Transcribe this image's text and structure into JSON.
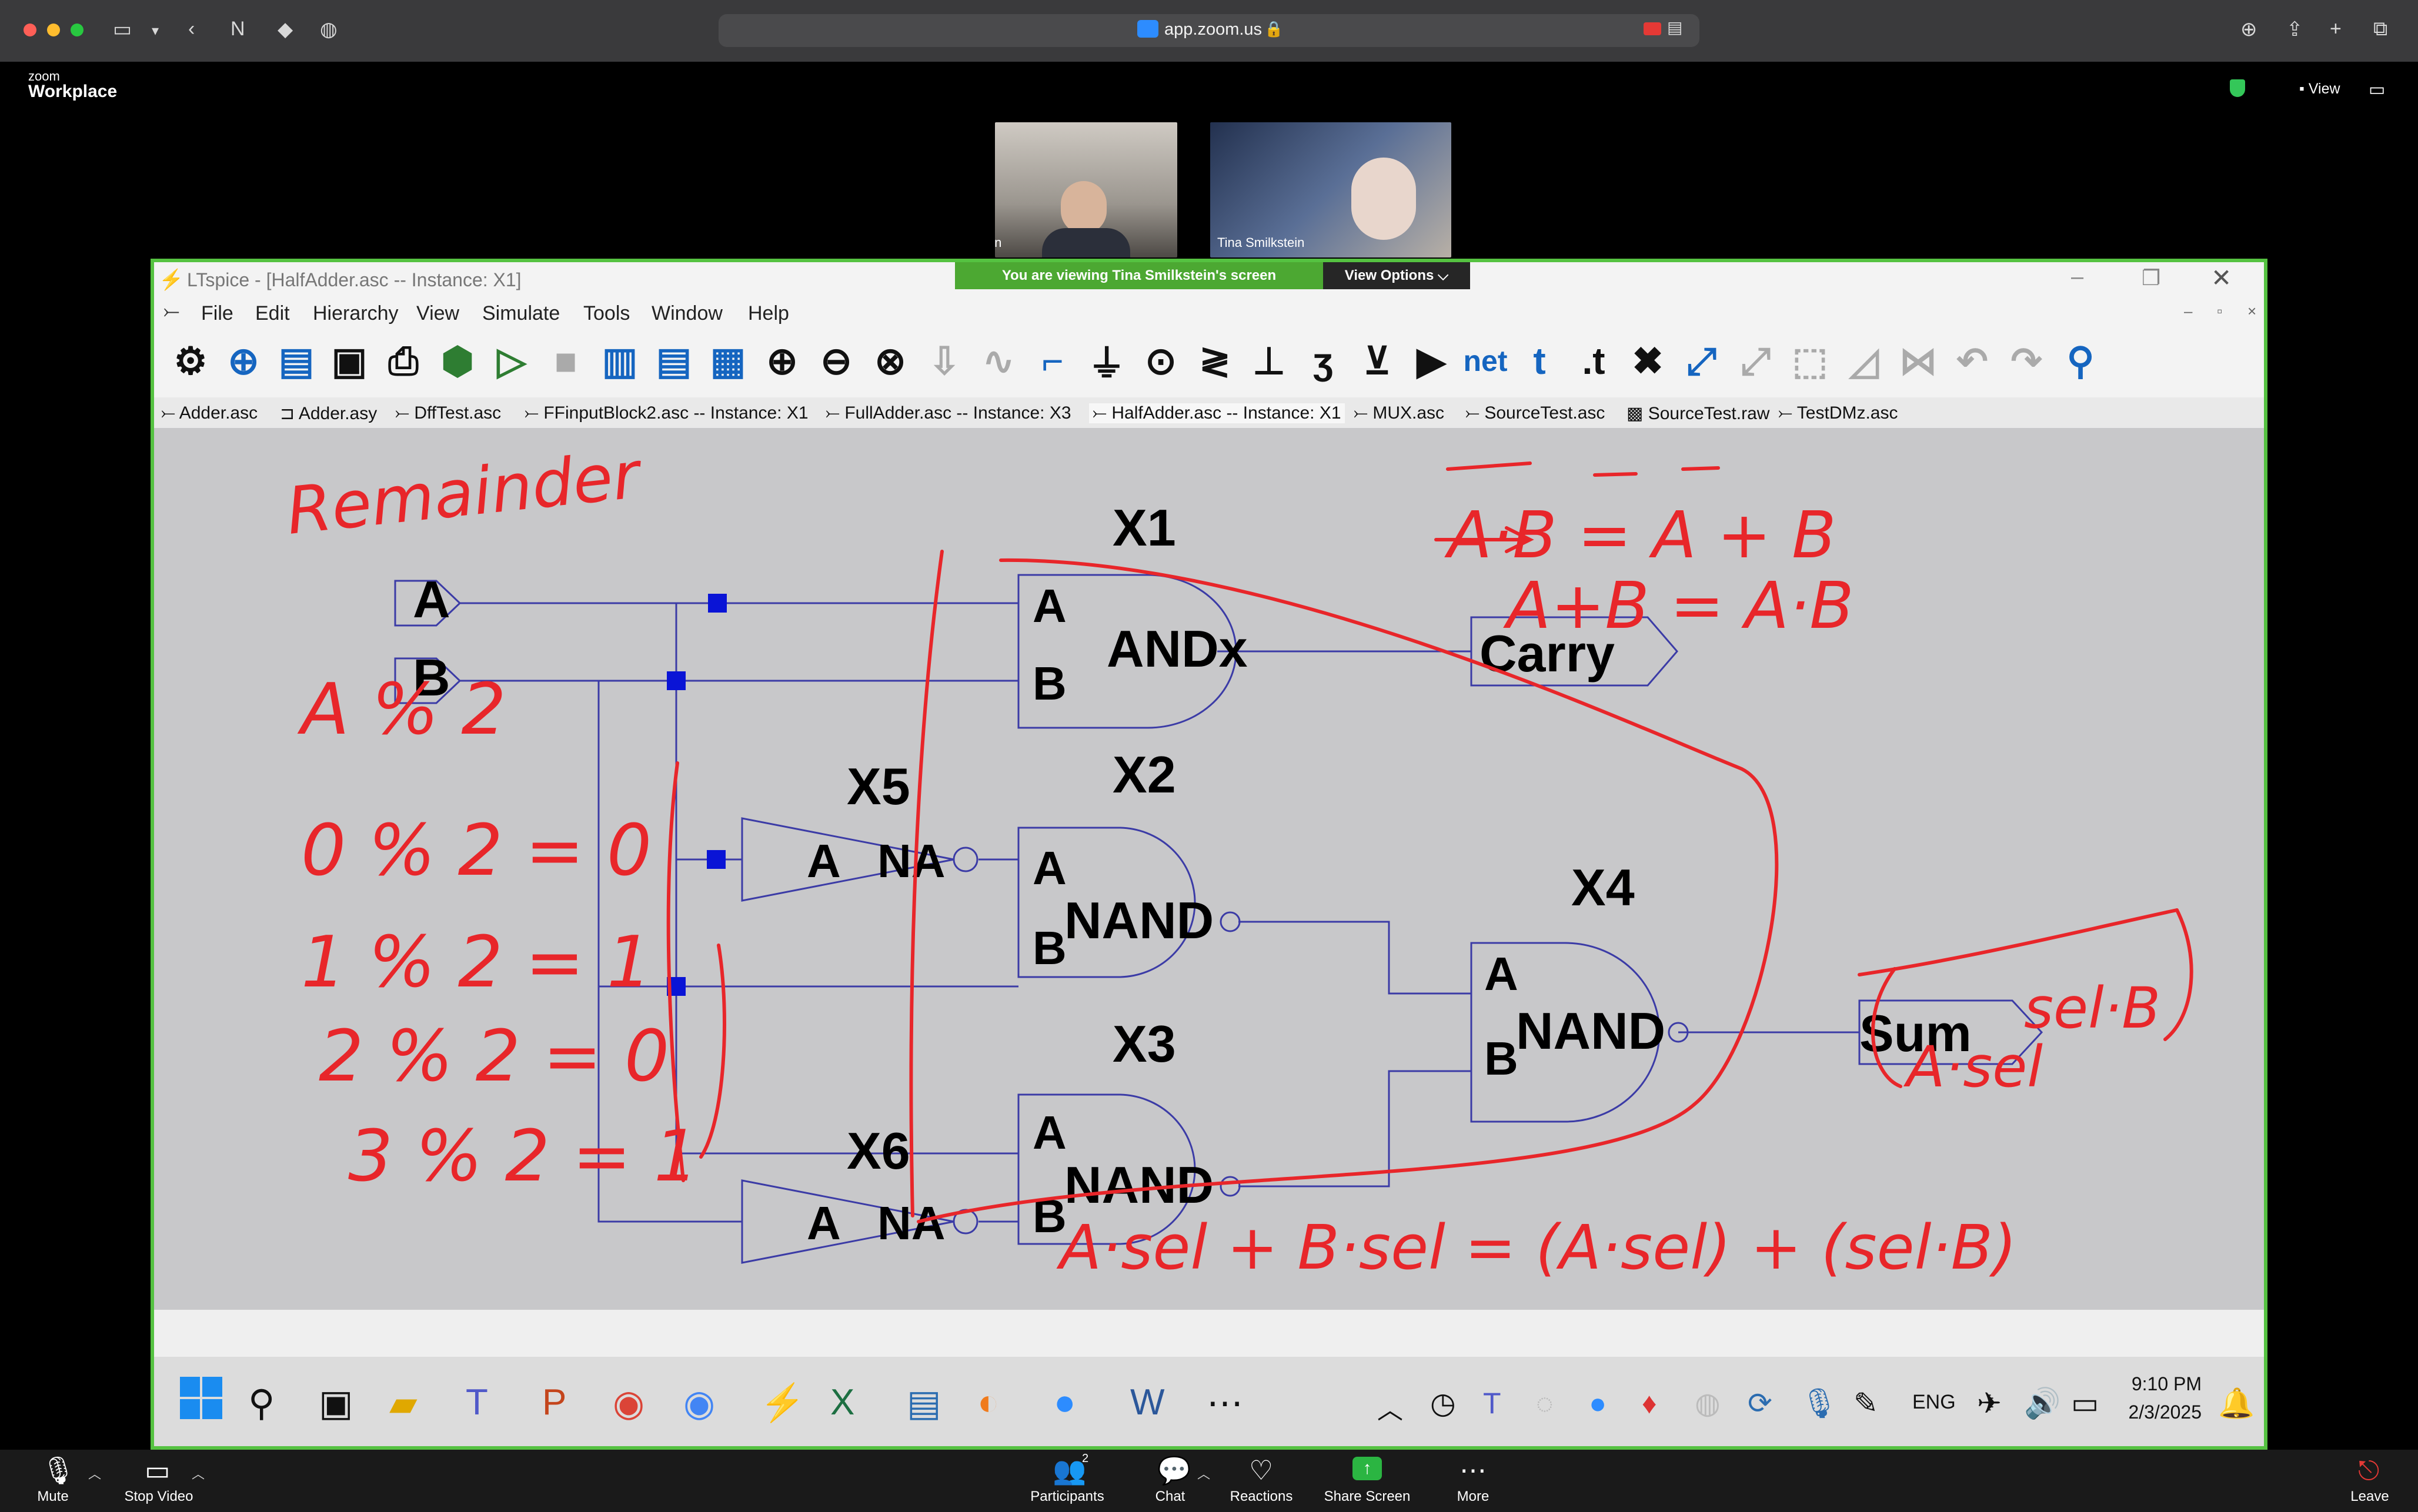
{
  "browser": {
    "url": "app.zoom.us"
  },
  "zoom": {
    "brand_small": "zoom",
    "brand": "Workplace",
    "view_label": "View",
    "participants": [
      {
        "name": "Ryan"
      },
      {
        "name": "Tina Smilkstein"
      }
    ],
    "banner": "You are viewing  Tina Smilkstein's screen",
    "view_options": "View Options ⌵",
    "controls": {
      "mute": "Mute",
      "stop_video": "Stop Video",
      "participants": "Participants",
      "participants_count": "2",
      "chat": "Chat",
      "reactions": "Reactions",
      "share_screen": "Share Screen",
      "more": "More",
      "leave": "Leave"
    }
  },
  "ltspice": {
    "title": "LTspice - [HalfAdder.asc -- Instance: X1]",
    "menu": [
      "File",
      "Edit",
      "Hierarchy",
      "View",
      "Simulate",
      "Tools",
      "Window",
      "Help"
    ],
    "toolbar_text": {
      "net": "net",
      "t": "t",
      "dt": ".t"
    },
    "tabs": [
      "Adder.asc",
      "Adder.asy",
      "DffTest.asc",
      "FFinputBlock2.asc -- Instance: X1",
      "FullAdder.asc -- Instance: X3",
      "HalfAdder.asc -- Instance: X1",
      "MUX.asc",
      "SourceTest.asc",
      "SourceTest.raw",
      "TestDMz.asc"
    ],
    "schematic": {
      "inputs": [
        "A",
        "B"
      ],
      "outputs": [
        "Carry",
        "Sum"
      ],
      "instances": [
        "X1",
        "X2",
        "X3",
        "X4",
        "X5",
        "X6"
      ],
      "gate_labels": {
        "and": "ANDx",
        "nand": "NAND",
        "not": "NA",
        "pin_a": "A",
        "pin_b": "B"
      }
    },
    "annotations": {
      "remainder": "Remainder",
      "a_mod_2": "A % 2",
      "lines": [
        "0 % 2 = 0",
        "1 % 2 = 1",
        "2 % 2 = 0",
        "3 % 2 = 1"
      ],
      "demorgan1": "A·B = A + B",
      "demorgan2": "A+B = A·B",
      "mux": "A·sel + B·sel = (A·sel) + (sel·B)",
      "sum_note_left": "A·sel",
      "sum_note_right": "sel·B"
    }
  },
  "windows_taskbar": {
    "lang": "ENG",
    "time": "9:10 PM",
    "date": "2/3/2025"
  },
  "colors": {
    "ink": "#e8262a",
    "wire": "#3b3ba6",
    "share_border": "#55c241"
  }
}
